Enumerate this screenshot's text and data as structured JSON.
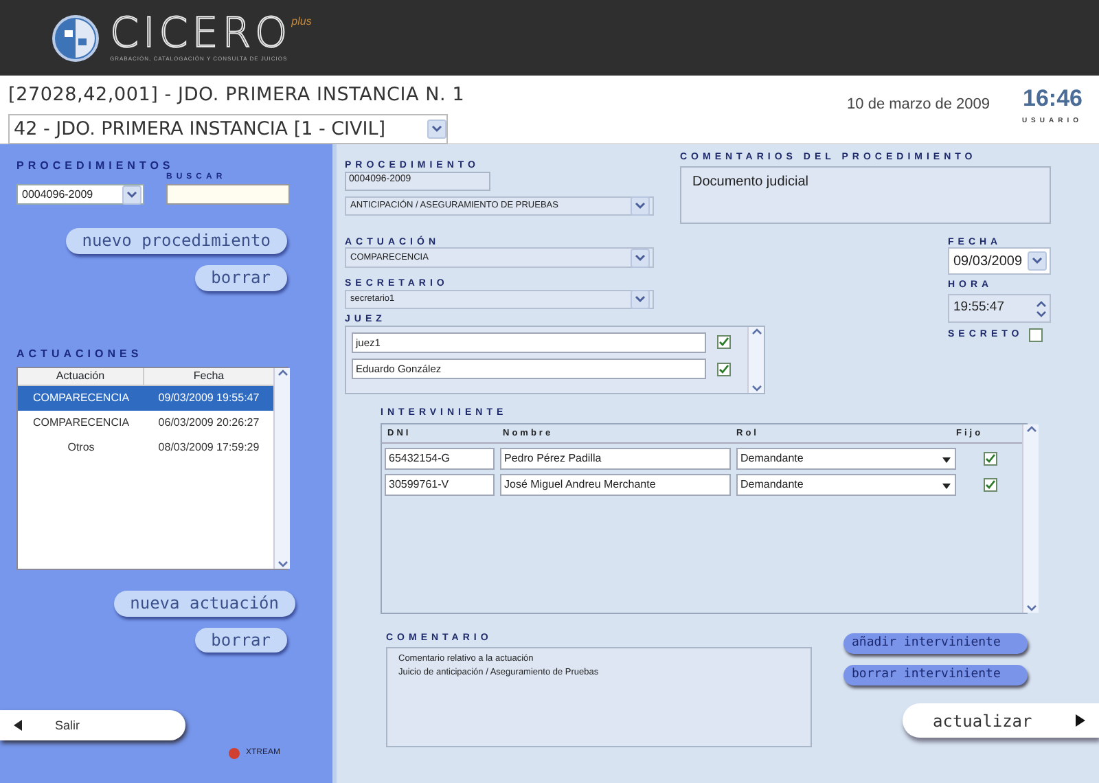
{
  "header": {
    "logo_text": "CICERO",
    "logo_superscript": "plus",
    "logo_tagline": "GRABACIÓN, CATALOGACIÓN Y CONSULTA DE JUICIOS"
  },
  "court": {
    "title": "[27028,42,001] - JDO. PRIMERA INSTANCIA N. 1",
    "selector": "42 - JDO. PRIMERA INSTANCIA [1 - CIVIL]"
  },
  "session": {
    "date": "10 de marzo de 2009",
    "time": "16:46",
    "user_label": "USUARIO"
  },
  "sidebar": {
    "procedimientos_label": "PROCEDIMIENTOS",
    "procedimiento_select": "0004096-2009",
    "buscar_label": "BUSCAR",
    "buttons_top": [
      "nuevo procedimiento",
      "borrar"
    ],
    "actuaciones_label": "ACTUACIONES",
    "actuaciones_columns": [
      "Actuación",
      "Fecha"
    ],
    "actuaciones_rows": [
      {
        "actuacion": "COMPARECENCIA",
        "fecha": "09/03/2009 19:55:47",
        "selected": true
      },
      {
        "actuacion": "COMPARECENCIA",
        "fecha": "06/03/2009 20:26:27",
        "selected": false
      },
      {
        "actuacion": "Otros",
        "fecha": "08/03/2009 17:59:29",
        "selected": false
      }
    ],
    "buttons_bottom": [
      "nueva actuación",
      "borrar"
    ],
    "exit_button": "Salir",
    "brand": "XTREAM"
  },
  "form": {
    "procedimiento_label": "PROCEDIMIENTO",
    "procedimiento_value": "0004096-2009",
    "tipo_select": "ANTICIPACIÓN / ASEGURAMIENTO DE PRUEBAS",
    "comentarios_label": "COMENTARIOS DEL PROCEDIMIENTO",
    "comentarios_value": "Documento judicial",
    "actuacion_label": "ACTUACIÓN",
    "actuacion_select": "COMPARECENCIA",
    "secretario_label": "SECRETARIO",
    "secretario_select": "secretario1",
    "juez_label": "JUEZ",
    "jueces": [
      {
        "name": "juez1",
        "checked": true
      },
      {
        "name": "Eduardo González",
        "checked": true
      }
    ],
    "fecha_label": "FECHA",
    "fecha_value": "09/03/2009",
    "hora_label": "HORA",
    "hora_value": "19:55:47",
    "secreto_label": "SECRETO",
    "secreto_checked": false,
    "interviniente_label": "INTERVINIENTE",
    "interviniente_columns": [
      "DNI",
      "Nombre",
      "Rol",
      "Fijo"
    ],
    "intervinientes": [
      {
        "dni": "65432154-G",
        "nombre": "Pedro Pérez Padilla",
        "rol": "Demandante",
        "fijo": true
      },
      {
        "dni": "30599761-V",
        "nombre": "José Miguel Andreu Merchante",
        "rol": "Demandante",
        "fijo": true
      }
    ],
    "comentario_label": "COMENTARIO",
    "comentario_lines": [
      "Comentario relativo a la actuación",
      "Juicio de anticipación / Aseguramiento de Pruebas"
    ],
    "side_buttons": [
      "añadir interviniente",
      "borrar interviniente"
    ],
    "update_button": "actualizar"
  }
}
